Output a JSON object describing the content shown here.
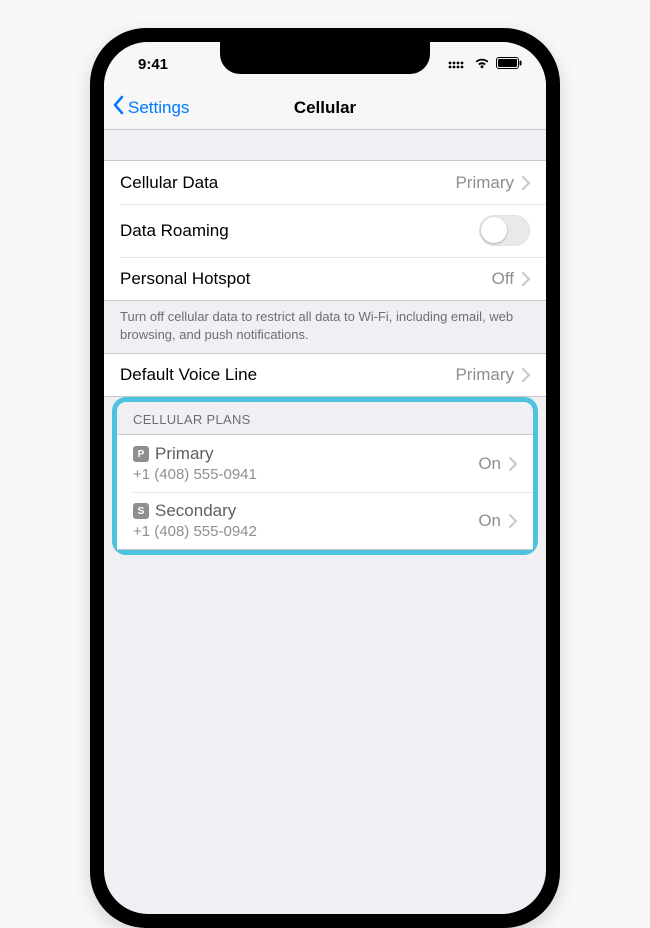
{
  "status": {
    "time": "9:41"
  },
  "nav": {
    "back": "Settings",
    "title": "Cellular"
  },
  "rows": {
    "cellular_data": {
      "label": "Cellular Data",
      "value": "Primary"
    },
    "data_roaming": {
      "label": "Data Roaming"
    },
    "personal_hotspot": {
      "label": "Personal Hotspot",
      "value": "Off"
    },
    "footer": "Turn off cellular data to restrict all data to Wi-Fi, including email, web browsing, and push notifications.",
    "default_voice": {
      "label": "Default Voice Line",
      "value": "Primary"
    }
  },
  "plans": {
    "header": "CELLULAR PLANS",
    "items": [
      {
        "badge": "P",
        "name": "Primary",
        "number": "+1 (408) 555-0941",
        "status": "On"
      },
      {
        "badge": "S",
        "name": "Secondary",
        "number": "+1 (408) 555-0942",
        "status": "On"
      }
    ]
  }
}
